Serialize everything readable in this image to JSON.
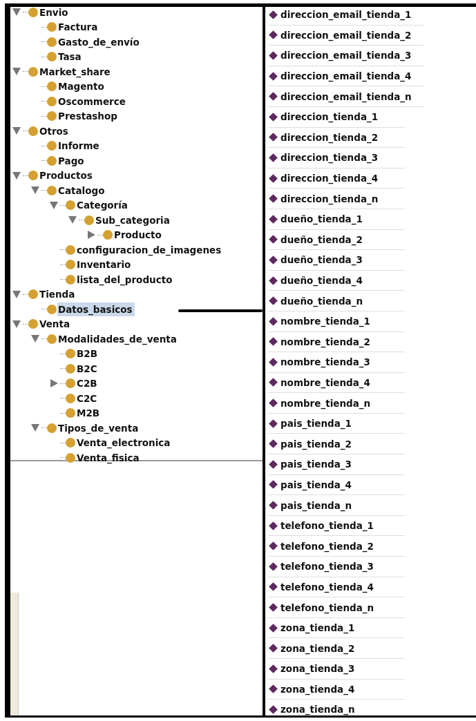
{
  "class_tree": [
    {
      "label": "Envio",
      "kind": "open",
      "selected": false,
      "children": [
        {
          "label": "Factura",
          "kind": "leaf",
          "selected": false
        },
        {
          "label": "Gasto_de_envío",
          "kind": "leaf",
          "selected": false
        },
        {
          "label": "Tasa",
          "kind": "leaf",
          "selected": false
        }
      ]
    },
    {
      "label": "Market_share",
      "kind": "open",
      "selected": false,
      "children": [
        {
          "label": "Magento",
          "kind": "leaf",
          "selected": false
        },
        {
          "label": "Oscommerce",
          "kind": "leaf",
          "selected": false
        },
        {
          "label": "Prestashop",
          "kind": "leaf",
          "selected": false
        }
      ]
    },
    {
      "label": "Otros",
      "kind": "open",
      "selected": false,
      "children": [
        {
          "label": "Informe",
          "kind": "leaf",
          "selected": false
        },
        {
          "label": "Pago",
          "kind": "leaf",
          "selected": false
        }
      ]
    },
    {
      "label": "Productos",
      "kind": "open",
      "selected": false,
      "children": [
        {
          "label": "Catalogo",
          "kind": "open",
          "selected": false,
          "children": [
            {
              "label": "Categoría",
              "kind": "open",
              "selected": false,
              "children": [
                {
                  "label": "Sub_categoria",
                  "kind": "open",
                  "selected": false,
                  "children": [
                    {
                      "label": "Producto",
                      "kind": "closed",
                      "selected": false
                    }
                  ]
                }
              ]
            },
            {
              "label": "configuracion_de_imagenes",
              "kind": "leaf",
              "selected": false
            },
            {
              "label": "Inventario",
              "kind": "leaf",
              "selected": false
            },
            {
              "label": "lista_del_producto",
              "kind": "leaf",
              "selected": false
            }
          ]
        }
      ]
    },
    {
      "label": "Tienda",
      "kind": "open",
      "selected": false,
      "children": [
        {
          "label": "Datos_basicos",
          "kind": "leaf",
          "selected": true
        }
      ]
    },
    {
      "label": "Venta",
      "kind": "open",
      "selected": false,
      "children": [
        {
          "label": "Modalidades_de_venta",
          "kind": "open",
          "selected": false,
          "children": [
            {
              "label": "B2B",
              "kind": "leaf",
              "selected": false
            },
            {
              "label": "B2C",
              "kind": "leaf",
              "selected": false
            },
            {
              "label": "C2B",
              "kind": "closed",
              "selected": false
            },
            {
              "label": "C2C",
              "kind": "leaf",
              "selected": false
            },
            {
              "label": "M2B",
              "kind": "leaf",
              "selected": false
            }
          ]
        },
        {
          "label": "Tipos_de_venta",
          "kind": "open",
          "selected": false,
          "children": [
            {
              "label": "Venta_electronica",
              "kind": "leaf",
              "selected": false
            },
            {
              "label": "Venta_fisica",
              "kind": "leaf",
              "selected": false
            }
          ]
        }
      ]
    }
  ],
  "properties": [
    "direccion_email_tienda_1",
    "direccion_email_tienda_2",
    "direccion_email_tienda_3",
    "direccion_email_tienda_4",
    "direccion_email_tienda_n",
    "direccion_tienda_1",
    "direccion_tienda_2",
    "direccion_tienda_3",
    "direccion_tienda_4",
    "direccion_tienda_n",
    "dueño_tienda_1",
    "dueño_tienda_2",
    "dueño_tienda_3",
    "dueño_tienda_4",
    "dueño_tienda_n",
    "nombre_tienda_1",
    "nombre_tienda_2",
    "nombre_tienda_3",
    "nombre_tienda_4",
    "nombre_tienda_n",
    "pais_tienda_1",
    "pais_tienda_2",
    "pais_tienda_3",
    "pais_tienda_4",
    "pais_tienda_n",
    "telefono_tienda_1",
    "telefono_tienda_2",
    "telefono_tienda_3",
    "telefono_tienda_4",
    "telefono_tienda_n",
    "zona_tienda_1",
    "zona_tienda_2",
    "zona_tienda_3",
    "zona_tienda_4",
    "zona_tienda_n"
  ]
}
